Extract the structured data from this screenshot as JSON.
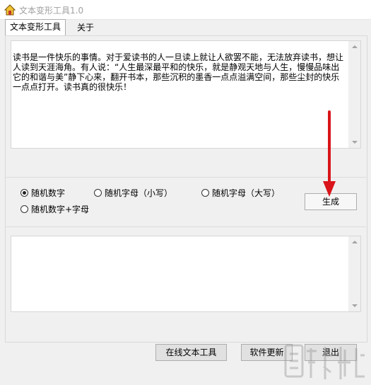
{
  "window": {
    "title": "文本变形工具1.0"
  },
  "tabs": [
    {
      "label": "文本变形工具",
      "active": true
    },
    {
      "label": "关于",
      "active": false
    }
  ],
  "input_text": "读书是一件快乐的事情。对于爱读书的人一旦读上就让人欲罢不能，无法放弃读书，想让人读到天涯海角。有人说：“人生最深最平和的快乐，就是静观天地与人生，慢慢品味出它的和谐与美”静下心来，翻开书本，那些沉积的墨香一点点溢满空间，那些尘封的快乐一点点打开。读书真的很快乐！",
  "options": [
    {
      "label": "随机数字",
      "checked": true
    },
    {
      "label": "随机字母（小写）",
      "checked": false
    },
    {
      "label": "随机字母（大写）",
      "checked": false
    },
    {
      "label": "随机数字+字母",
      "checked": false
    }
  ],
  "buttons": {
    "generate": "生成",
    "online_tools": "在线文本工具",
    "software_update": "软件更新",
    "exit": "退出"
  },
  "output_text": "",
  "colors": {
    "annotation_arrow": "#d9141a",
    "title_text": "#a0a0a0"
  }
}
